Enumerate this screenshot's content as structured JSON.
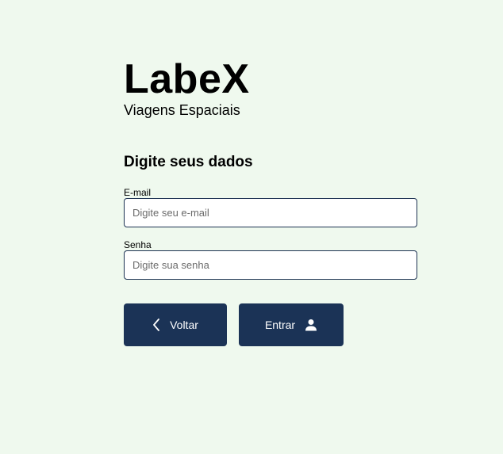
{
  "brand": {
    "title": "LabeX",
    "subtitle": "Viagens Espaciais"
  },
  "form": {
    "heading": "Digite seus dados",
    "email": {
      "label": "E-mail",
      "placeholder": "Digite seu e-mail",
      "value": ""
    },
    "password": {
      "label": "Senha",
      "placeholder": "Digite sua senha",
      "value": ""
    }
  },
  "actions": {
    "back_label": "Voltar",
    "back_icon": "chevron-left-icon",
    "enter_label": "Entrar",
    "enter_icon": "user-icon"
  },
  "colors": {
    "background": "#eff9ee",
    "button": "#1b3356",
    "input_border": "#1c3252"
  }
}
